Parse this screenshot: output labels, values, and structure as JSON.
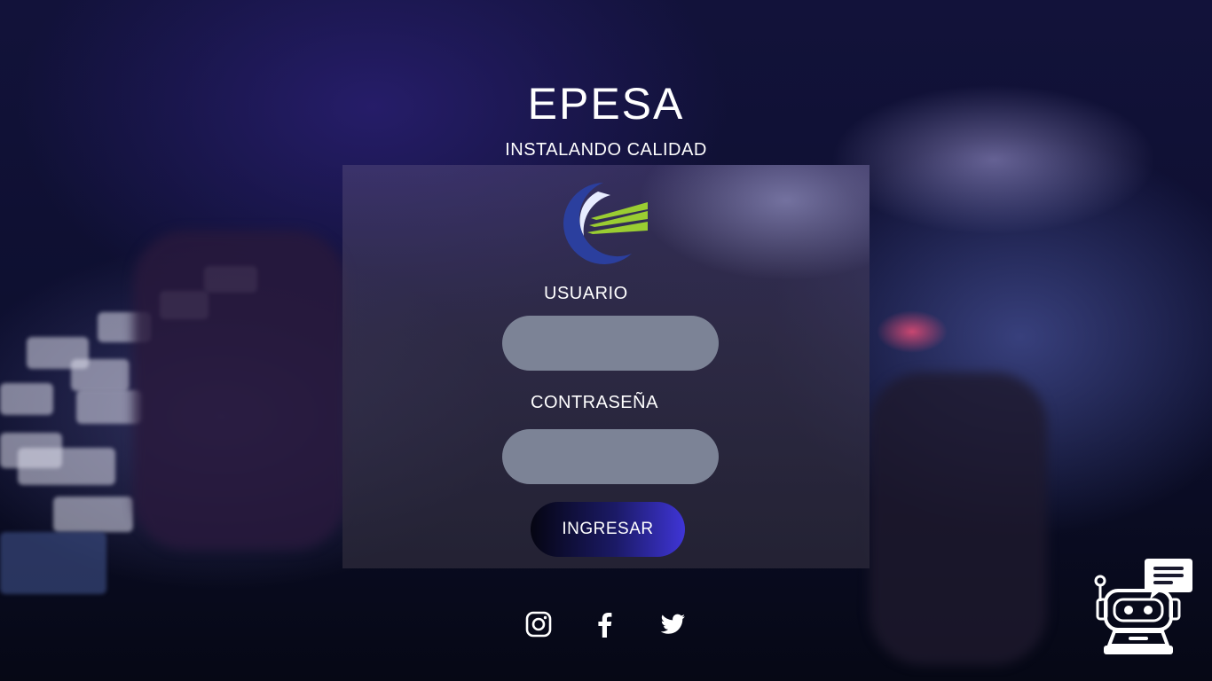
{
  "brand": {
    "title": "EPESA",
    "subtitle": "INSTALANDO CALIDAD"
  },
  "login": {
    "username_label": "USUARIO",
    "username_value": "",
    "password_label": "CONTRASEÑA",
    "password_value": "",
    "submit_label": "INGRESAR"
  },
  "social": [
    "instagram-icon",
    "facebook-icon",
    "twitter-icon"
  ],
  "chatbot": {
    "icon": "chatbot-robot-icon"
  },
  "colors": {
    "input_bg": "#7c8396",
    "button_start": "#050512",
    "button_end": "#3f35d6",
    "logo_blue": "#2b3f9e",
    "logo_green": "#9acd32"
  }
}
